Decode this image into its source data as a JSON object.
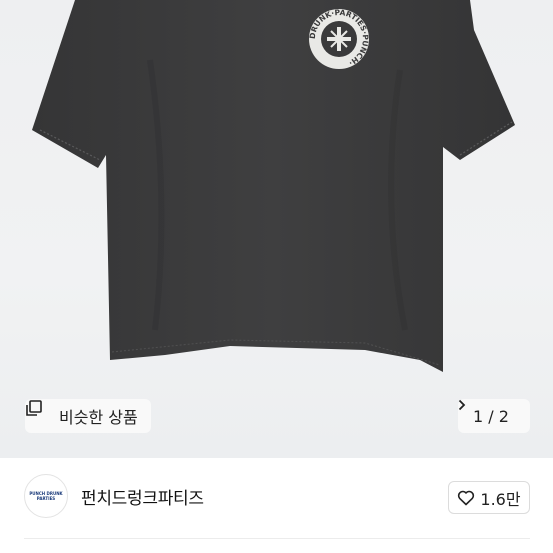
{
  "product_image": {
    "description_icon": "black-tshirt-image",
    "logo_ring_text": "DRUNK·PARTIES·PUNCH·"
  },
  "similar": {
    "label": "비슷한 상품",
    "icon": "similar-items-icon"
  },
  "pager": {
    "current": "1",
    "separator": "/",
    "total": "2",
    "text": "1 / 2"
  },
  "seller": {
    "name": "펀치드렁크파티즈",
    "avatar_text": "PUNCH DRUNK PARTIES"
  },
  "like": {
    "count": "1.6만",
    "icon": "heart-outline-icon"
  },
  "colors": {
    "shirt": "#3a3a3b",
    "background": "#eff0f2",
    "text": "#222222"
  }
}
